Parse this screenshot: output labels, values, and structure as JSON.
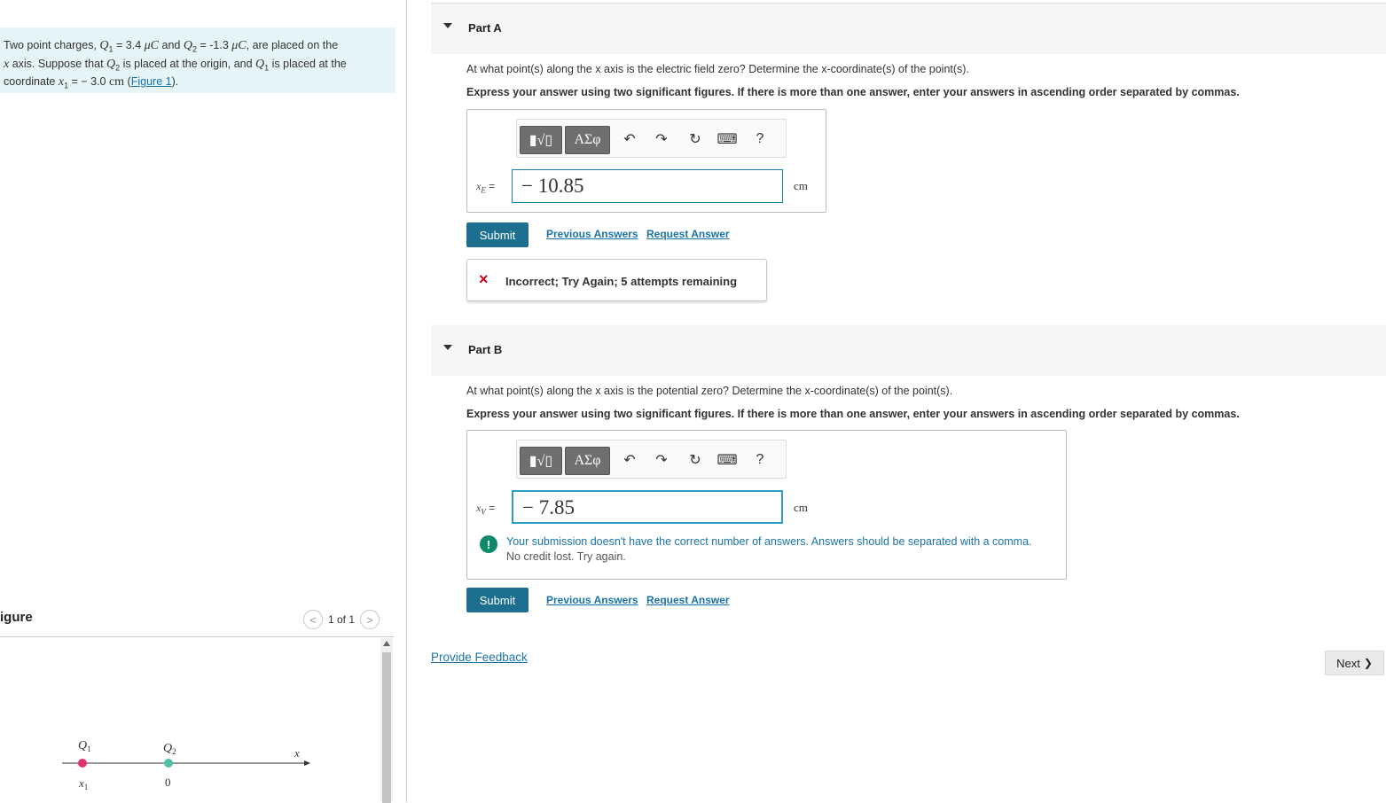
{
  "problem": {
    "text_1": "Two point charges,",
    "q1_sym": "Q",
    "q1_sub": "1",
    "q1_val": " = 3.4 ",
    "micro_c": "μC",
    "text_and": " and ",
    "q2_sym": "Q",
    "q2_sub": "2",
    "q2_val": " = -1.3 ",
    "text_2": ", are placed on the",
    "x_sym": "x",
    "text_3": " axis. Suppose that ",
    "text_4": " is placed at the origin, and ",
    "text_5": " is placed at the coordinate ",
    "x1_sub": "1",
    "x1_val": " = − 3.0 ",
    "unit_cm": "cm",
    "figure_link": "Figure 1",
    "paren_open": " (",
    "paren_close": ")."
  },
  "figure_panel": {
    "title": "igure",
    "pager": "1 of 1",
    "prev": "<",
    "next": ">",
    "labels": {
      "q1": "Q",
      "q1_sub": "1",
      "q2": "Q",
      "q2_sub": "2",
      "x": "x",
      "x1": "x",
      "x1_sub": "1",
      "zero": "0"
    },
    "colors": {
      "q1": "#e0356b",
      "q2": "#4fbfa8"
    }
  },
  "part_a": {
    "label": "Part A",
    "question": "At what point(s) along the x axis is the electric field zero? Determine the x-coordinate(s) of the point(s).",
    "instructions": "Express your answer using two significant figures. If there is more than one answer, enter your answers in ascending order separated by commas.",
    "var_main": "x",
    "var_sub": "E",
    "eq": " =",
    "value": "− 10.85",
    "unit": "cm",
    "submit": "Submit",
    "previous_answers": "Previous Answers",
    "request_answer": "Request Answer",
    "feedback": "Incorrect; Try Again; 5 attempts remaining",
    "feedback_icon": "×"
  },
  "part_b": {
    "label": "Part B",
    "question": "At what point(s) along the x axis is the potential zero? Determine the x-coordinate(s) of the point(s).",
    "instructions": "Express your answer using two significant figures. If there is more than one answer, enter your answers in ascending order separated by commas.",
    "var_main": "x",
    "var_sub": "V",
    "eq": " =",
    "value": "− 7.85",
    "unit": "cm",
    "warning_line1": "Your submission doesn't have the correct number of answers. Answers should be separated with a comma.",
    "warning_line2": "No credit lost. Try again.",
    "warning_icon": "!",
    "submit": "Submit",
    "previous_answers": "Previous Answers",
    "request_answer": "Request Answer"
  },
  "toolbar": {
    "templates": "▮√▯",
    "greek": "ΑΣφ",
    "undo": "↶",
    "redo": "↷",
    "reset": "↻",
    "keyboard": "⌨",
    "help": "?"
  },
  "footer": {
    "provide_feedback": "Provide Feedback",
    "next": "Next",
    "next_chevron": "❯"
  }
}
